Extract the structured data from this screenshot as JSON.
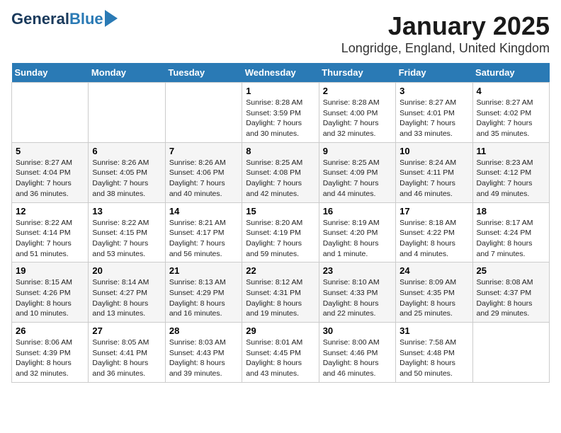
{
  "logo": {
    "name_part1": "General",
    "name_part2": "Blue"
  },
  "title": "January 2025",
  "subtitle": "Longridge, England, United Kingdom",
  "days_of_week": [
    "Sunday",
    "Monday",
    "Tuesday",
    "Wednesday",
    "Thursday",
    "Friday",
    "Saturday"
  ],
  "weeks": [
    [
      {
        "day": "",
        "sunrise": "",
        "sunset": "",
        "daylight": ""
      },
      {
        "day": "",
        "sunrise": "",
        "sunset": "",
        "daylight": ""
      },
      {
        "day": "",
        "sunrise": "",
        "sunset": "",
        "daylight": ""
      },
      {
        "day": "1",
        "sunrise": "Sunrise: 8:28 AM",
        "sunset": "Sunset: 3:59 PM",
        "daylight": "Daylight: 7 hours and 30 minutes."
      },
      {
        "day": "2",
        "sunrise": "Sunrise: 8:28 AM",
        "sunset": "Sunset: 4:00 PM",
        "daylight": "Daylight: 7 hours and 32 minutes."
      },
      {
        "day": "3",
        "sunrise": "Sunrise: 8:27 AM",
        "sunset": "Sunset: 4:01 PM",
        "daylight": "Daylight: 7 hours and 33 minutes."
      },
      {
        "day": "4",
        "sunrise": "Sunrise: 8:27 AM",
        "sunset": "Sunset: 4:02 PM",
        "daylight": "Daylight: 7 hours and 35 minutes."
      }
    ],
    [
      {
        "day": "5",
        "sunrise": "Sunrise: 8:27 AM",
        "sunset": "Sunset: 4:04 PM",
        "daylight": "Daylight: 7 hours and 36 minutes."
      },
      {
        "day": "6",
        "sunrise": "Sunrise: 8:26 AM",
        "sunset": "Sunset: 4:05 PM",
        "daylight": "Daylight: 7 hours and 38 minutes."
      },
      {
        "day": "7",
        "sunrise": "Sunrise: 8:26 AM",
        "sunset": "Sunset: 4:06 PM",
        "daylight": "Daylight: 7 hours and 40 minutes."
      },
      {
        "day": "8",
        "sunrise": "Sunrise: 8:25 AM",
        "sunset": "Sunset: 4:08 PM",
        "daylight": "Daylight: 7 hours and 42 minutes."
      },
      {
        "day": "9",
        "sunrise": "Sunrise: 8:25 AM",
        "sunset": "Sunset: 4:09 PM",
        "daylight": "Daylight: 7 hours and 44 minutes."
      },
      {
        "day": "10",
        "sunrise": "Sunrise: 8:24 AM",
        "sunset": "Sunset: 4:11 PM",
        "daylight": "Daylight: 7 hours and 46 minutes."
      },
      {
        "day": "11",
        "sunrise": "Sunrise: 8:23 AM",
        "sunset": "Sunset: 4:12 PM",
        "daylight": "Daylight: 7 hours and 49 minutes."
      }
    ],
    [
      {
        "day": "12",
        "sunrise": "Sunrise: 8:22 AM",
        "sunset": "Sunset: 4:14 PM",
        "daylight": "Daylight: 7 hours and 51 minutes."
      },
      {
        "day": "13",
        "sunrise": "Sunrise: 8:22 AM",
        "sunset": "Sunset: 4:15 PM",
        "daylight": "Daylight: 7 hours and 53 minutes."
      },
      {
        "day": "14",
        "sunrise": "Sunrise: 8:21 AM",
        "sunset": "Sunset: 4:17 PM",
        "daylight": "Daylight: 7 hours and 56 minutes."
      },
      {
        "day": "15",
        "sunrise": "Sunrise: 8:20 AM",
        "sunset": "Sunset: 4:19 PM",
        "daylight": "Daylight: 7 hours and 59 minutes."
      },
      {
        "day": "16",
        "sunrise": "Sunrise: 8:19 AM",
        "sunset": "Sunset: 4:20 PM",
        "daylight": "Daylight: 8 hours and 1 minute."
      },
      {
        "day": "17",
        "sunrise": "Sunrise: 8:18 AM",
        "sunset": "Sunset: 4:22 PM",
        "daylight": "Daylight: 8 hours and 4 minutes."
      },
      {
        "day": "18",
        "sunrise": "Sunrise: 8:17 AM",
        "sunset": "Sunset: 4:24 PM",
        "daylight": "Daylight: 8 hours and 7 minutes."
      }
    ],
    [
      {
        "day": "19",
        "sunrise": "Sunrise: 8:15 AM",
        "sunset": "Sunset: 4:26 PM",
        "daylight": "Daylight: 8 hours and 10 minutes."
      },
      {
        "day": "20",
        "sunrise": "Sunrise: 8:14 AM",
        "sunset": "Sunset: 4:27 PM",
        "daylight": "Daylight: 8 hours and 13 minutes."
      },
      {
        "day": "21",
        "sunrise": "Sunrise: 8:13 AM",
        "sunset": "Sunset: 4:29 PM",
        "daylight": "Daylight: 8 hours and 16 minutes."
      },
      {
        "day": "22",
        "sunrise": "Sunrise: 8:12 AM",
        "sunset": "Sunset: 4:31 PM",
        "daylight": "Daylight: 8 hours and 19 minutes."
      },
      {
        "day": "23",
        "sunrise": "Sunrise: 8:10 AM",
        "sunset": "Sunset: 4:33 PM",
        "daylight": "Daylight: 8 hours and 22 minutes."
      },
      {
        "day": "24",
        "sunrise": "Sunrise: 8:09 AM",
        "sunset": "Sunset: 4:35 PM",
        "daylight": "Daylight: 8 hours and 25 minutes."
      },
      {
        "day": "25",
        "sunrise": "Sunrise: 8:08 AM",
        "sunset": "Sunset: 4:37 PM",
        "daylight": "Daylight: 8 hours and 29 minutes."
      }
    ],
    [
      {
        "day": "26",
        "sunrise": "Sunrise: 8:06 AM",
        "sunset": "Sunset: 4:39 PM",
        "daylight": "Daylight: 8 hours and 32 minutes."
      },
      {
        "day": "27",
        "sunrise": "Sunrise: 8:05 AM",
        "sunset": "Sunset: 4:41 PM",
        "daylight": "Daylight: 8 hours and 36 minutes."
      },
      {
        "day": "28",
        "sunrise": "Sunrise: 8:03 AM",
        "sunset": "Sunset: 4:43 PM",
        "daylight": "Daylight: 8 hours and 39 minutes."
      },
      {
        "day": "29",
        "sunrise": "Sunrise: 8:01 AM",
        "sunset": "Sunset: 4:45 PM",
        "daylight": "Daylight: 8 hours and 43 minutes."
      },
      {
        "day": "30",
        "sunrise": "Sunrise: 8:00 AM",
        "sunset": "Sunset: 4:46 PM",
        "daylight": "Daylight: 8 hours and 46 minutes."
      },
      {
        "day": "31",
        "sunrise": "Sunrise: 7:58 AM",
        "sunset": "Sunset: 4:48 PM",
        "daylight": "Daylight: 8 hours and 50 minutes."
      },
      {
        "day": "",
        "sunrise": "",
        "sunset": "",
        "daylight": ""
      }
    ]
  ]
}
